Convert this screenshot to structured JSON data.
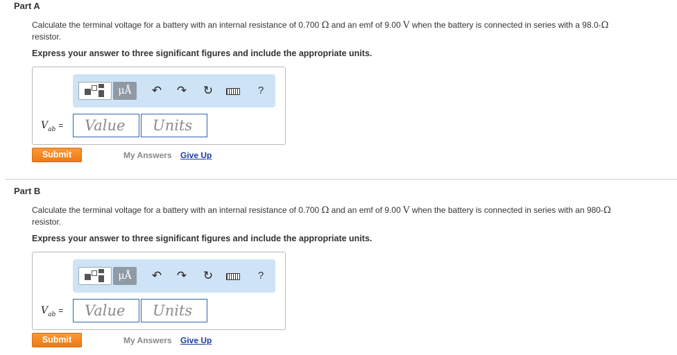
{
  "parts": [
    {
      "title": "Part A",
      "question_pre": "Calculate the terminal voltage for a battery with an internal resistance of 0.700 ",
      "ohm1": "Ω",
      "question_mid1": " and an emf of 9.00 ",
      "volt": "V",
      "question_mid2": " when the battery is connected in series with a 98.0-",
      "ohm2": "Ω",
      "question_post": "resistor.",
      "instruction": "Express your answer to three significant figures and include the appropriate units.",
      "toolbar": {
        "symbols_label": "μÅ",
        "undo_glyph": "↶",
        "redo_glyph": "↷",
        "reset_glyph": "↻",
        "help_label": "?"
      },
      "variable": "V",
      "variable_sub": "ab",
      "equals": "=",
      "value_placeholder": "Value",
      "units_placeholder": "Units",
      "submit_label": "Submit",
      "my_answers_label": "My Answers",
      "give_up_label": "Give Up"
    },
    {
      "title": "Part B",
      "question_pre": "Calculate the terminal voltage for a battery with an internal resistance of 0.700 ",
      "ohm1": "Ω",
      "question_mid1": " and an emf of 9.00 ",
      "volt": "V",
      "question_mid2": " when the battery is connected in series with an 980-",
      "ohm2": "Ω",
      "question_post": "resistor.",
      "instruction": "Express your answer to three significant figures and include the appropriate units.",
      "toolbar": {
        "symbols_label": "μÅ",
        "undo_glyph": "↶",
        "redo_glyph": "↷",
        "reset_glyph": "↻",
        "help_label": "?"
      },
      "variable": "V",
      "variable_sub": "ab",
      "equals": "=",
      "value_placeholder": "Value",
      "units_placeholder": "Units",
      "submit_label": "Submit",
      "my_answers_label": "My Answers",
      "give_up_label": "Give Up"
    }
  ],
  "icons": {
    "templates": "templates-icon",
    "undo": "undo-icon",
    "redo": "redo-icon",
    "reset": "reset-icon",
    "keyboard": "keyboard-icon",
    "help": "help-icon"
  },
  "colors": {
    "submit": "#ee7a12",
    "toolbar": "#cfe3f7",
    "link": "#1a3c9c",
    "input_border": "#2d66a8"
  }
}
